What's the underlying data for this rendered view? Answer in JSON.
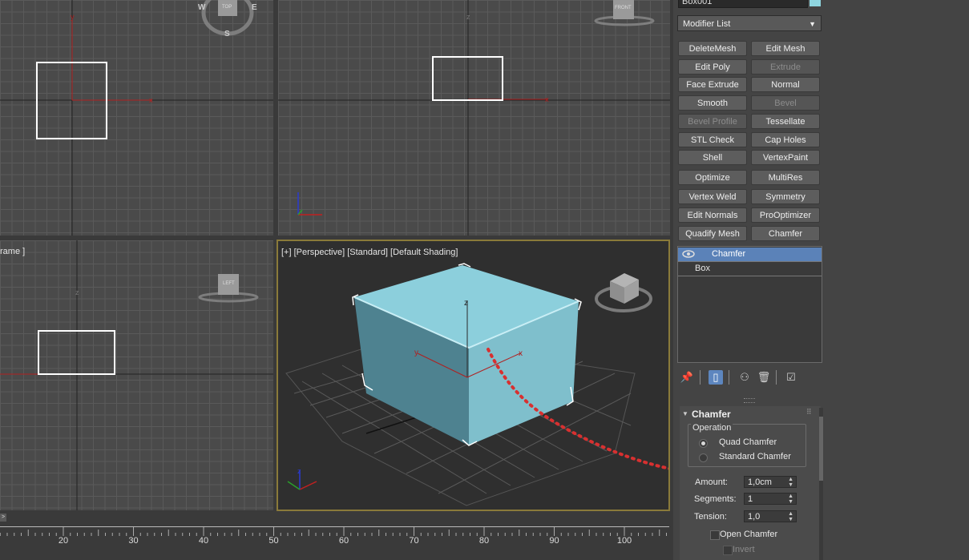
{
  "viewports": {
    "top": {
      "viewcube_label": "TOP",
      "compass": {
        "w": "W",
        "e": "E",
        "s": "S"
      }
    },
    "front": {
      "viewcube_label": "FRONT"
    },
    "left": {
      "label_fragment": "rame ]",
      "viewcube_label": "LEFT"
    },
    "perspective": {
      "label": "[+] [Perspective] [Standard] [Default Shading]",
      "viewcube_label": "TOP"
    }
  },
  "timeline": {
    "ticks": [
      "20",
      "30",
      "40",
      "50",
      "60",
      "70",
      "80",
      "90",
      "100"
    ]
  },
  "panel": {
    "object_name": "Box001",
    "object_color": "#8fd6e0",
    "modifier_list_label": "Modifier List",
    "modifier_buttons": [
      {
        "label": "DeleteMesh",
        "enabled": true
      },
      {
        "label": "Edit Mesh",
        "enabled": true
      },
      {
        "label": "Edit Poly",
        "enabled": true
      },
      {
        "label": "Extrude",
        "enabled": false
      },
      {
        "label": "Face Extrude",
        "enabled": true
      },
      {
        "label": "Normal",
        "enabled": true
      },
      {
        "label": "Smooth",
        "enabled": true
      },
      {
        "label": "Bevel",
        "enabled": false
      },
      {
        "label": "Bevel Profile",
        "enabled": false
      },
      {
        "label": "Tessellate",
        "enabled": true
      },
      {
        "label": "STL Check",
        "enabled": true
      },
      {
        "label": "Cap Holes",
        "enabled": true
      },
      {
        "label": "Shell",
        "enabled": true
      },
      {
        "label": "VertexPaint",
        "enabled": true
      },
      {
        "label": "Optimize",
        "enabled": true
      },
      {
        "label": "MultiRes",
        "enabled": true
      },
      {
        "label": "Vertex Weld",
        "enabled": true
      },
      {
        "label": "Symmetry",
        "enabled": true
      },
      {
        "label": "Edit Normals",
        "enabled": true
      },
      {
        "label": "ProOptimizer",
        "enabled": true
      },
      {
        "label": "Quadify Mesh",
        "enabled": true
      },
      {
        "label": "Chamfer",
        "enabled": true
      }
    ],
    "stack": [
      {
        "label": "Chamfer",
        "selected": true
      },
      {
        "label": "Box",
        "selected": false
      }
    ],
    "stack_tools": [
      "pin-stack-icon",
      "show-end-result-icon",
      "make-unique-icon",
      "remove-modifier-icon",
      "configure-sets-icon"
    ],
    "rollout": {
      "title": "Chamfer",
      "operation_group": "Operation",
      "operations": [
        {
          "label": "Quad Chamfer",
          "selected": true
        },
        {
          "label": "Standard Chamfer",
          "selected": false
        }
      ],
      "amount_label": "Amount:",
      "amount_value": "1,0cm",
      "segments_label": "Segments:",
      "segments_value": "1",
      "tension_label": "Tension:",
      "tension_value": "1,0",
      "open_chamfer_label": "Open Chamfer",
      "invert_label": "Invert"
    }
  }
}
